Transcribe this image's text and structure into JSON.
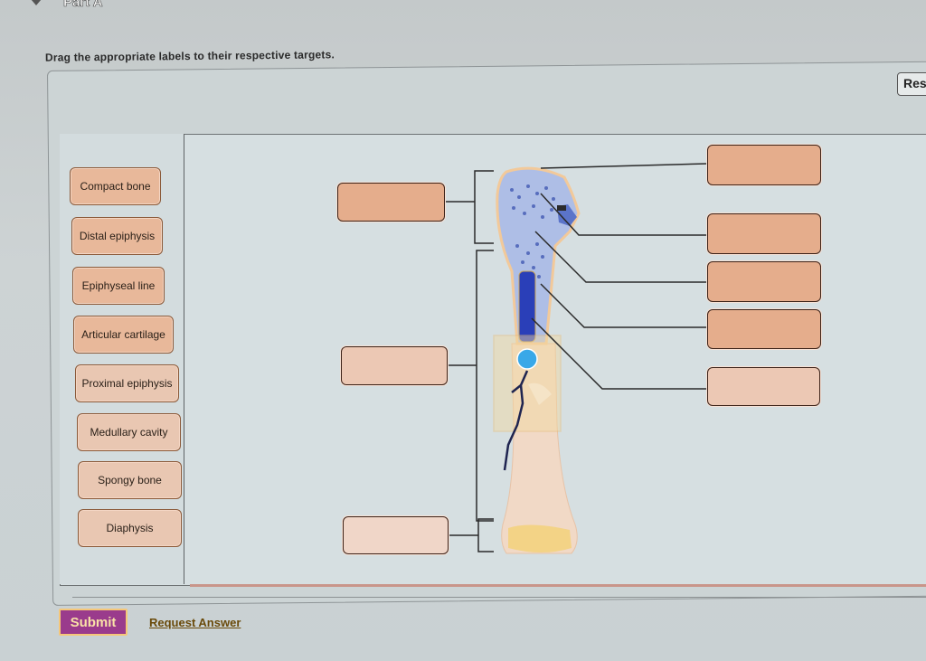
{
  "header": {
    "part_title": "Part A",
    "instructions": "Drag the appropriate labels to their respective targets."
  },
  "toolbar": {
    "reset_label": "Res"
  },
  "label_bank": {
    "labels": [
      "Compact bone",
      "Distal epiphysis",
      "Epiphyseal line",
      "Articular cartilage",
      "Proximal epiphysis",
      "Medullary cavity",
      "Spongy bone",
      "Diaphysis"
    ]
  },
  "diagram": {
    "subject": "Long bone (humerus) cross-section",
    "left_targets": [
      {
        "id": "left-top",
        "value": "",
        "points_to": "upper bracket"
      },
      {
        "id": "left-middle",
        "value": "",
        "points_to": "middle bracket"
      },
      {
        "id": "left-bottom",
        "value": "",
        "points_to": "lower bracket"
      }
    ],
    "right_targets": [
      {
        "id": "right-1",
        "value": ""
      },
      {
        "id": "right-2",
        "value": ""
      },
      {
        "id": "right-3",
        "value": ""
      },
      {
        "id": "right-4",
        "value": ""
      },
      {
        "id": "right-5",
        "value": ""
      }
    ],
    "colors": {
      "target_fill": "#e5ad8c",
      "label_fill": "#e8b89a",
      "spongy_blue": "#5b74c9",
      "marrow_blue": "#2a3fb8",
      "bone_cream": "#f1d9c6"
    }
  },
  "footer": {
    "submit_label": "Submit",
    "request_answer_label": "Request Answer",
    "submit_color": "#9a3b8c"
  }
}
